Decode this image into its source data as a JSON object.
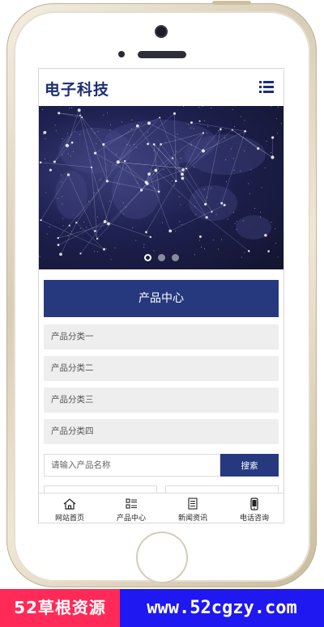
{
  "header": {
    "site_title": "电子科技"
  },
  "banner": {
    "slide_count": 3,
    "active_slide": 1
  },
  "product_center": {
    "title": "产品中心",
    "categories": [
      {
        "label": "产品分类一"
      },
      {
        "label": "产品分类二"
      },
      {
        "label": "产品分类三"
      },
      {
        "label": "产品分类四"
      }
    ]
  },
  "search": {
    "placeholder": "请输入产品名称",
    "button_label": "搜索"
  },
  "bottom_nav": [
    {
      "label": "网站首页",
      "icon": "home-icon"
    },
    {
      "label": "产品中心",
      "icon": "product-list-icon"
    },
    {
      "label": "新闻资讯",
      "icon": "news-document-icon"
    },
    {
      "label": "电话咨询",
      "icon": "phone-icon"
    }
  ],
  "watermark": {
    "left_text": "52草根资源",
    "right_text": "www.52cgzy.com"
  },
  "colors": {
    "brand_navy": "#26397f",
    "watermark_red": "#ff2a57",
    "watermark_blue": "#1f18f0"
  }
}
